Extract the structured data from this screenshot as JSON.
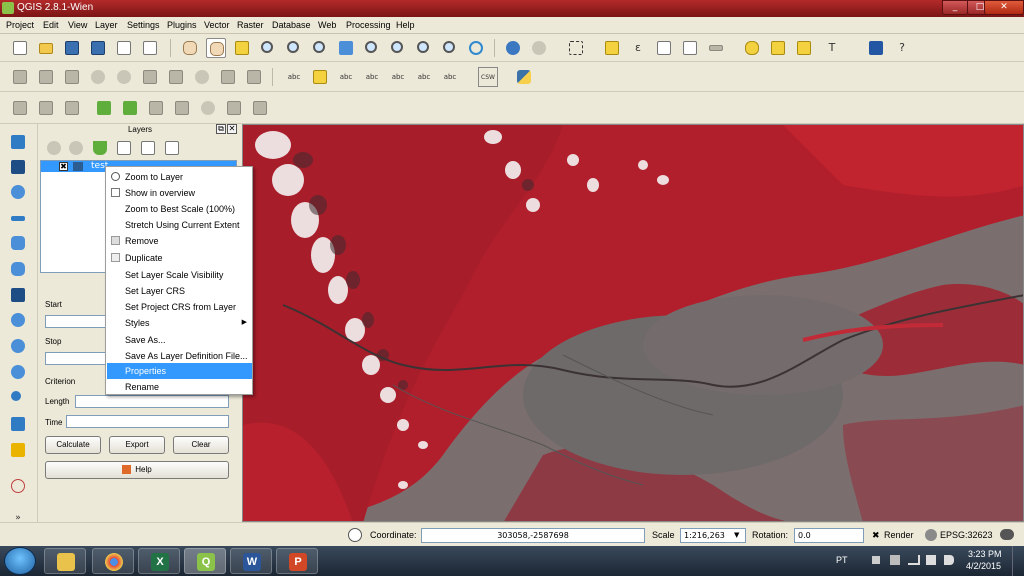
{
  "window": {
    "title": "QGIS 2.8.1-Wien",
    "minimize": "_",
    "maximize": "□",
    "close": "✕"
  },
  "menu": [
    "Project",
    "Edit",
    "View",
    "Layer",
    "Settings",
    "Plugins",
    "Vector",
    "Raster",
    "Database",
    "Web",
    "Processing",
    "Help"
  ],
  "layers_panel": {
    "title": "Layers",
    "layer_name": "test",
    "labels": {
      "start": "Start",
      "stop": "Stop",
      "criterion": "Criterion",
      "length": "Length",
      "time": "Time"
    },
    "buttons": {
      "calculate": "Calculate",
      "export": "Export",
      "clear": "Clear",
      "help": "Help"
    },
    "float_icon": "⧉",
    "close_icon": "✕"
  },
  "context_menu": [
    "Zoom to Layer",
    "Show in overview",
    "Zoom to Best Scale (100%)",
    "Stretch Using Current Extent",
    "Remove",
    "Duplicate",
    "Set Layer Scale Visibility",
    "Set Layer CRS",
    "Set Project CRS from Layer",
    "Styles",
    "Save As...",
    "Save As Layer Definition File...",
    "Properties",
    "Rename"
  ],
  "context_menu_selected": "Properties",
  "context_menu_submenu_arrow": "▶",
  "toolbar_glyphs": {
    "epsilon": "ε",
    "question": "?",
    "csw": "CSW",
    "abc": "abc",
    "text_tool": "T"
  },
  "statusbar": {
    "coordinate_label": "Coordinate:",
    "coordinate_value": "303058,-2587698",
    "scale_label": "Scale",
    "scale_value": "1:216,263",
    "rotation_label": "Rotation:",
    "rotation_value": "0.0",
    "render_label": "Render",
    "crs": "EPSG:32623",
    "render_checked_glyph": "✖"
  },
  "taskbar": {
    "lang": "PT",
    "time": "3:23 PM",
    "date": "4/2/2015",
    "apps": [
      "file-explorer",
      "chrome",
      "excel",
      "qgis",
      "word",
      "powerpoint"
    ]
  },
  "colors": {
    "vegetation_red": "#b5202e",
    "urban_gray": "#7b6e6e",
    "selection_blue": "#3399ff",
    "title_bar": "#9c2727"
  }
}
